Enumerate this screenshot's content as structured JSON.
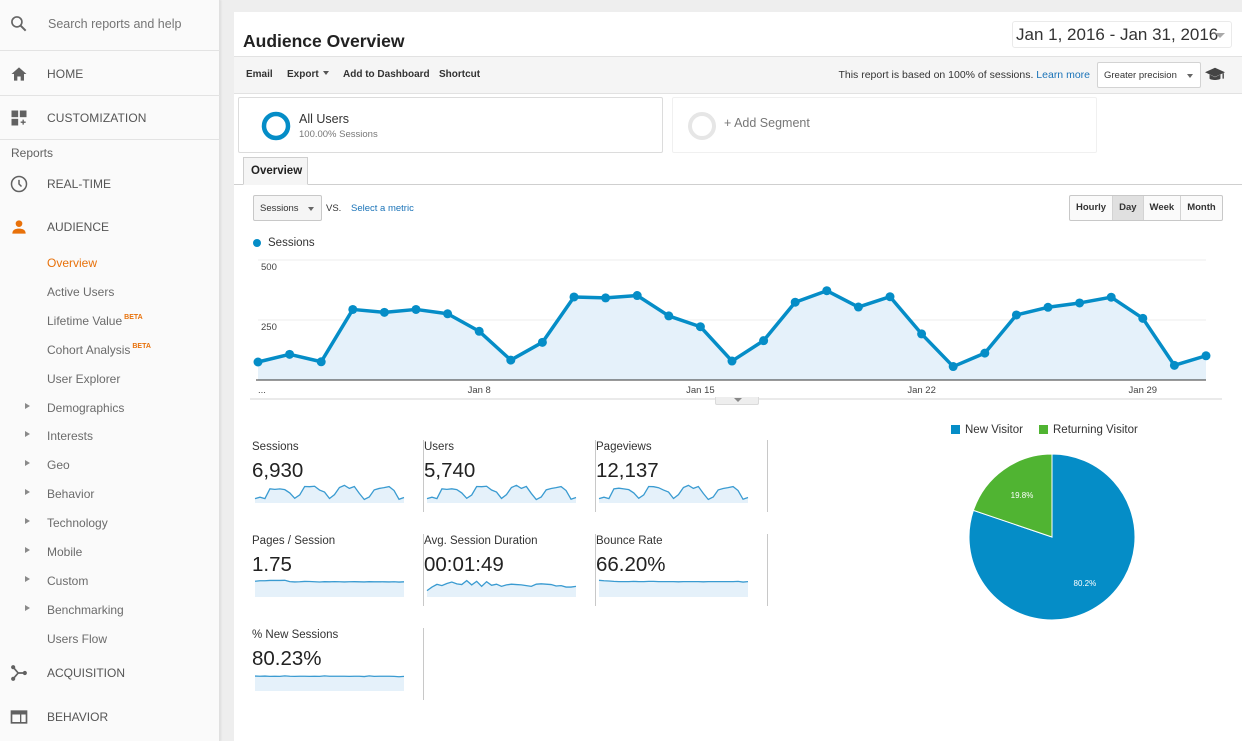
{
  "sidebar": {
    "search_placeholder": "Search reports and help",
    "top_items": [
      {
        "label": "HOME",
        "icon": "home-icon"
      },
      {
        "label": "CUSTOMIZATION",
        "icon": "dashboard-add-icon"
      }
    ],
    "reports_heading": "Reports",
    "sections": [
      {
        "label": "REAL-TIME",
        "icon": "clock-icon"
      },
      {
        "label": "AUDIENCE",
        "icon": "person-icon",
        "active": true
      },
      {
        "label": "ACQUISITION",
        "icon": "acquisition-icon"
      },
      {
        "label": "BEHAVIOR",
        "icon": "behavior-window-icon"
      }
    ],
    "audience_items": [
      {
        "label": "Overview",
        "active": true,
        "expandable": false
      },
      {
        "label": "Active Users",
        "expandable": false
      },
      {
        "label": "Lifetime Value",
        "badge": "BETA",
        "expandable": false
      },
      {
        "label": "Cohort Analysis",
        "badge": "BETA",
        "expandable": false
      },
      {
        "label": "User Explorer",
        "expandable": false
      },
      {
        "label": "Demographics",
        "expandable": true
      },
      {
        "label": "Interests",
        "expandable": true
      },
      {
        "label": "Geo",
        "expandable": true
      },
      {
        "label": "Behavior",
        "expandable": true
      },
      {
        "label": "Technology",
        "expandable": true
      },
      {
        "label": "Mobile",
        "expandable": true
      },
      {
        "label": "Custom",
        "expandable": true
      },
      {
        "label": "Benchmarking",
        "expandable": true
      },
      {
        "label": "Users Flow",
        "expandable": false
      }
    ],
    "accent_color": "#e8710a"
  },
  "header": {
    "title": "Audience Overview",
    "date_range": "Jan 1, 2016 - Jan 31, 2016"
  },
  "toolbar": {
    "email": "Email",
    "export": "Export",
    "add_to_dashboard": "Add to Dashboard",
    "shortcut": "Shortcut",
    "sampling_note": "This report is based on 100% of sessions.",
    "learn_more": "Learn more",
    "precision_select": "Greater precision",
    "help_icon": "graduation-cap-icon"
  },
  "segments": {
    "active": {
      "name": "All Users",
      "detail": "100.00% Sessions"
    },
    "add_label": "+ Add Segment"
  },
  "tabs": [
    {
      "label": "Overview",
      "active": true
    }
  ],
  "chart_controls": {
    "metric": "Sessions",
    "vs": "VS.",
    "select_metric": "Select a metric",
    "granularity": [
      {
        "label": "Hourly",
        "active": false
      },
      {
        "label": "Day",
        "active": true
      },
      {
        "label": "Week",
        "active": false
      },
      {
        "label": "Month",
        "active": false
      }
    ]
  },
  "colors": {
    "primary": "#058dc7",
    "secondary": "#50b432",
    "area_fill": "#e5f1fa",
    "link": "#1a73b8"
  },
  "chart_data": [
    {
      "type": "area",
      "title": "",
      "legend": [
        "Sessions"
      ],
      "xlabel": "",
      "ylabel": "",
      "ylim": [
        0,
        500
      ],
      "yticks": [
        "250",
        "500"
      ],
      "ytick_values": [
        250,
        500
      ],
      "x": [
        "Jan 1",
        "Jan 2",
        "Jan 3",
        "Jan 4",
        "Jan 5",
        "Jan 6",
        "Jan 7",
        "Jan 8",
        "Jan 9",
        "Jan 10",
        "Jan 11",
        "Jan 12",
        "Jan 13",
        "Jan 14",
        "Jan 15",
        "Jan 16",
        "Jan 17",
        "Jan 18",
        "Jan 19",
        "Jan 20",
        "Jan 21",
        "Jan 22",
        "Jan 23",
        "Jan 24",
        "Jan 25",
        "Jan 26",
        "Jan 27",
        "Jan 28",
        "Jan 29",
        "Jan 30",
        "Jan 31"
      ],
      "xtick_labels": [
        {
          "label": "...",
          "index": 0
        },
        {
          "label": "Jan 8",
          "index": 7
        },
        {
          "label": "Jan 15",
          "index": 14
        },
        {
          "label": "Jan 22",
          "index": 21
        },
        {
          "label": "Jan 29",
          "index": 28
        }
      ],
      "series": [
        {
          "name": "Sessions",
          "values": [
            75,
            107,
            76,
            294,
            282,
            294,
            276,
            203,
            83,
            157,
            346,
            342,
            352,
            267,
            222,
            79,
            164,
            324,
            372,
            304,
            347,
            192,
            56,
            112,
            271,
            303,
            321,
            345,
            257,
            61,
            101
          ]
        }
      ],
      "grid": true
    },
    {
      "type": "pie",
      "legend_position": "top",
      "labels": [
        "New Visitor",
        "Returning Visitor"
      ],
      "values": [
        80.2,
        19.8
      ],
      "data_labels": [
        "80.2%",
        "19.8%"
      ]
    }
  ],
  "metrics": [
    {
      "label": "Sessions",
      "value": "6,930",
      "spark": [
        75,
        107,
        76,
        294,
        282,
        294,
        276,
        203,
        83,
        157,
        346,
        342,
        352,
        267,
        222,
        79,
        164,
        324,
        372,
        304,
        347,
        192,
        56,
        112,
        271,
        303,
        321,
        345,
        257,
        61,
        101
      ],
      "ylim": [
        0,
        380
      ]
    },
    {
      "label": "Users",
      "value": "5,740",
      "spark": [
        62,
        89,
        63,
        244,
        234,
        244,
        229,
        168,
        69,
        130,
        287,
        284,
        292,
        222,
        184,
        66,
        136,
        269,
        309,
        252,
        288,
        159,
        46,
        93,
        225,
        251,
        266,
        286,
        213,
        51,
        84
      ],
      "ylim": [
        0,
        315
      ]
    },
    {
      "label": "Pageviews",
      "value": "12,137",
      "spark": [
        131,
        187,
        133,
        515,
        540,
        515,
        483,
        355,
        145,
        275,
        606,
        599,
        560,
        467,
        389,
        138,
        287,
        567,
        651,
        532,
        607,
        336,
        98,
        196,
        474,
        530,
        562,
        604,
        450,
        107,
        177
      ],
      "ylim": [
        0,
        665
      ]
    },
    {
      "label": "Pages / Session",
      "value": "1.75",
      "spark": [
        1.82,
        1.88,
        1.88,
        1.92,
        1.93,
        1.92,
        1.94,
        1.78,
        1.74,
        1.76,
        1.8,
        1.79,
        1.76,
        1.73,
        1.77,
        1.75,
        1.78,
        1.76,
        1.74,
        1.76,
        1.77,
        1.75,
        1.74,
        1.77,
        1.75,
        1.76,
        1.75,
        1.74,
        1.76,
        1.72,
        1.75
      ],
      "ylim": [
        0,
        2.1
      ]
    },
    {
      "label": "Avg. Session Duration",
      "value": "00:01:49",
      "spark": [
        60,
        80,
        95,
        88,
        100,
        108,
        98,
        94,
        116,
        92,
        112,
        84,
        110,
        90,
        96,
        84,
        92,
        96,
        94,
        92,
        88,
        84,
        96,
        98,
        96,
        94,
        86,
        88,
        80,
        80,
        84
      ],
      "ylim": [
        30,
        125
      ]
    },
    {
      "label": "Bounce Rate",
      "value": "66.20%",
      "spark": [
        72,
        70,
        69,
        67,
        66,
        66,
        66,
        67,
        66,
        66,
        67,
        67,
        66,
        66,
        66,
        66,
        65,
        66,
        66,
        66,
        66,
        65,
        66,
        66,
        66,
        66,
        66,
        66,
        67,
        64,
        66
      ],
      "ylim": [
        0,
        78
      ]
    },
    {
      "label": "% New Sessions",
      "value": "80.23%",
      "spark": [
        82,
        81,
        82,
        80,
        81,
        80,
        83,
        81,
        80,
        81,
        81,
        80,
        81,
        80,
        83,
        81,
        81,
        81,
        81,
        80,
        81,
        81,
        79,
        83,
        80,
        81,
        81,
        81,
        80,
        78,
        80
      ],
      "ylim": [
        0,
        100
      ]
    }
  ]
}
